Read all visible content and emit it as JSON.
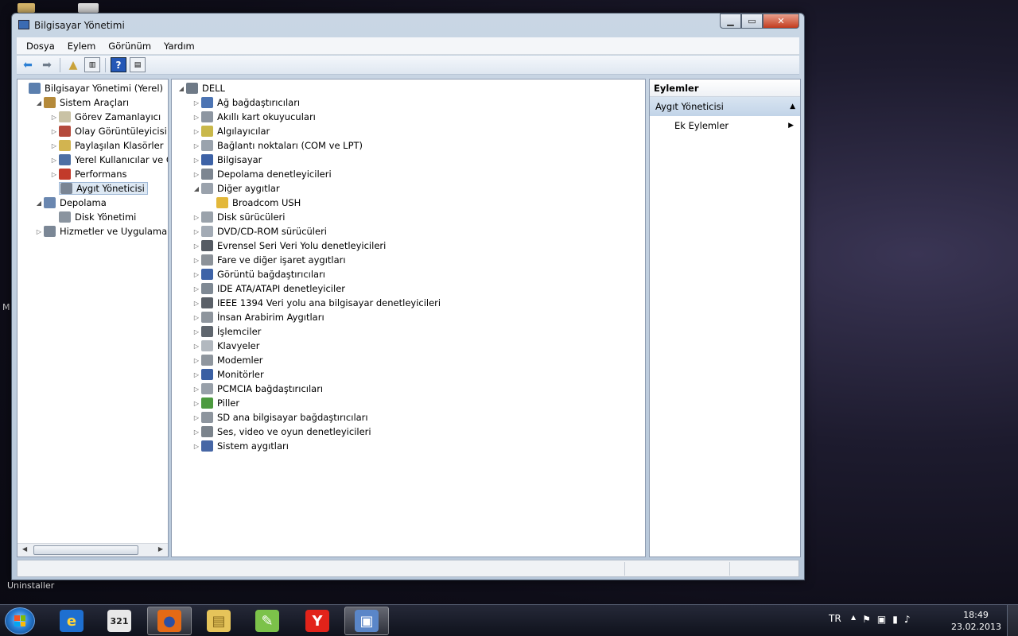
{
  "window": {
    "title": "Bilgisayar Yönetimi",
    "controls": {
      "minimize": "▁",
      "maximize": "▭",
      "close": "✕"
    }
  },
  "menu": [
    "Dosya",
    "Eylem",
    "Görünüm",
    "Yardım"
  ],
  "toolbar": {
    "icons": [
      "back-arrow-icon",
      "forward-arrow-icon",
      "up-folder-icon",
      "show-hide-tree-icon",
      "help-icon",
      "show-hide-action-pane-icon"
    ],
    "help_glyph": "?"
  },
  "left_tree": [
    {
      "label": "Bilgisayar Yönetimi (Yerel)",
      "arrow": "",
      "icon": "computer-management-icon",
      "color": "#5b7fae"
    },
    {
      "label": "Sistem Araçları",
      "arrow": "◢",
      "icon": "tools-icon",
      "color": "#b58a3a"
    },
    {
      "label": "Görev Zamanlayıcı",
      "arrow": "▷",
      "icon": "clock-icon",
      "color": "#c9c2a5"
    },
    {
      "label": "Olay Görüntüleyicisi",
      "arrow": "▷",
      "icon": "event-viewer-icon",
      "color": "#b44a3c"
    },
    {
      "label": "Paylaşılan Klasörler",
      "arrow": "▷",
      "icon": "shared-folder-icon",
      "color": "#d2b450"
    },
    {
      "label": "Yerel Kullanıcılar ve Gru",
      "arrow": "▷",
      "icon": "users-icon",
      "color": "#4d6fa3"
    },
    {
      "label": "Performans",
      "arrow": "▷",
      "icon": "performance-icon",
      "color": "#c23a2a"
    },
    {
      "label": "Aygıt Yöneticisi",
      "arrow": "",
      "icon": "device-manager-icon",
      "color": "#7a8594",
      "selected": true
    },
    {
      "label": "Depolama",
      "arrow": "◢",
      "icon": "storage-icon",
      "color": "#6a87b0"
    },
    {
      "label": "Disk Yönetimi",
      "arrow": "",
      "icon": "disk-management-icon",
      "color": "#8a949f"
    },
    {
      "label": "Hizmetler ve Uygulamalar",
      "arrow": "▷",
      "icon": "services-icon",
      "color": "#7b8796"
    }
  ],
  "device_tree": {
    "root": {
      "label": "DELL",
      "arrow": "◢",
      "icon": "computer-icon",
      "color": "#6f7a87"
    },
    "items": [
      {
        "label": "Ağ bağdaştırıcıları",
        "arrow": "▷",
        "icon": "network-adapter-icon",
        "color": "#4c74b3"
      },
      {
        "label": "Akıllı kart okuyucuları",
        "arrow": "▷",
        "icon": "smart-card-icon",
        "color": "#8d96a1"
      },
      {
        "label": "Algılayıcılar",
        "arrow": "▷",
        "icon": "sensor-icon",
        "color": "#c9b84a"
      },
      {
        "label": "Bağlantı noktaları (COM ve LPT)",
        "arrow": "▷",
        "icon": "port-icon",
        "color": "#9aa3ad"
      },
      {
        "label": "Bilgisayar",
        "arrow": "▷",
        "icon": "monitor-icon",
        "color": "#3d62a6"
      },
      {
        "label": "Depolama denetleyicileri",
        "arrow": "▷",
        "icon": "storage-controller-icon",
        "color": "#7d8691"
      },
      {
        "label": "Diğer aygıtlar",
        "arrow": "◢",
        "icon": "unknown-device-icon",
        "color": "#9aa2ac"
      },
      {
        "label": "Broadcom USH",
        "arrow": "",
        "icon": "warning-device-icon",
        "color": "#e3b83a",
        "child": true
      },
      {
        "label": "Disk sürücüleri",
        "arrow": "▷",
        "icon": "disk-drive-icon",
        "color": "#9aa2ab"
      },
      {
        "label": "DVD/CD-ROM sürücüleri",
        "arrow": "▷",
        "icon": "dvd-drive-icon",
        "color": "#a3abb5"
      },
      {
        "label": "Evrensel Seri Veri Yolu denetleyicileri",
        "arrow": "▷",
        "icon": "usb-icon",
        "color": "#555b63"
      },
      {
        "label": "Fare ve diğer işaret aygıtları",
        "arrow": "▷",
        "icon": "mouse-icon",
        "color": "#8c9299"
      },
      {
        "label": "Görüntü bağdaştırıcıları",
        "arrow": "▷",
        "icon": "display-adapter-icon",
        "color": "#3e63a7"
      },
      {
        "label": "IDE ATA/ATAPI denetleyiciler",
        "arrow": "▷",
        "icon": "ide-icon",
        "color": "#7f8994"
      },
      {
        "label": "IEEE 1394 Veri yolu ana bilgisayar denetleyicileri",
        "arrow": "▷",
        "icon": "ieee1394-icon",
        "color": "#5a6068"
      },
      {
        "label": "İnsan Arabirim Aygıtları",
        "arrow": "▷",
        "icon": "hid-icon",
        "color": "#8e959d"
      },
      {
        "label": "İşlemciler",
        "arrow": "▷",
        "icon": "processor-icon",
        "color": "#5f666e"
      },
      {
        "label": "Klavyeler",
        "arrow": "▷",
        "icon": "keyboard-icon",
        "color": "#b2b8bf"
      },
      {
        "label": "Modemler",
        "arrow": "▷",
        "icon": "modem-icon",
        "color": "#8f969e"
      },
      {
        "label": "Monitörler",
        "arrow": "▷",
        "icon": "monitor-icon",
        "color": "#3a5fa3"
      },
      {
        "label": "PCMCIA bağdaştırıcıları",
        "arrow": "▷",
        "icon": "pcmcia-icon",
        "color": "#98a0a9"
      },
      {
        "label": "Piller",
        "arrow": "▷",
        "icon": "battery-icon",
        "color": "#4c9a3f"
      },
      {
        "label": "SD ana bilgisayar bağdaştırıcıları",
        "arrow": "▷",
        "icon": "sd-host-icon",
        "color": "#8d959e"
      },
      {
        "label": "Ses, video ve oyun denetleyicileri",
        "arrow": "▷",
        "icon": "speaker-icon",
        "color": "#7b838c"
      },
      {
        "label": "Sistem aygıtları",
        "arrow": "▷",
        "icon": "system-device-icon",
        "color": "#4666a5"
      }
    ]
  },
  "actions": {
    "title": "Eylemler",
    "section": "Aygıt Yöneticisi",
    "section_glyph": "▲",
    "item": "Ek Eylemler",
    "item_glyph": "▶"
  },
  "desktop": {
    "label": "Uninstaller",
    "edge_letter": "M"
  },
  "taskbar": {
    "apps": [
      {
        "name": "ie-icon",
        "glyph": "e",
        "bg": "#1e6fd0",
        "fg": "#ffd43a"
      },
      {
        "name": "media-center-icon",
        "glyph": "321",
        "bg": "#e8e8e8",
        "fg": "#222"
      },
      {
        "name": "firefox-icon",
        "glyph": "●",
        "bg": "#e46a16",
        "fg": "#2c4fa3",
        "active": true
      },
      {
        "name": "file-explorer-icon",
        "glyph": "▤",
        "bg": "#e6c45a",
        "fg": "#8a6d1e"
      },
      {
        "name": "notepad-plus-icon",
        "glyph": "✎",
        "bg": "#7cc24a",
        "fg": "#fff"
      },
      {
        "name": "yandex-icon",
        "glyph": "Y",
        "bg": "#e2231a",
        "fg": "#fff"
      },
      {
        "name": "computer-management-taskbar-icon",
        "glyph": "▣",
        "bg": "#5a86c8",
        "fg": "#fff",
        "active": true
      }
    ],
    "language": "TR",
    "tray_glyphs": [
      "▲",
      "⚑",
      "▣",
      "▮",
      "♪"
    ],
    "time": "18:49",
    "date": "23.02.2013"
  }
}
